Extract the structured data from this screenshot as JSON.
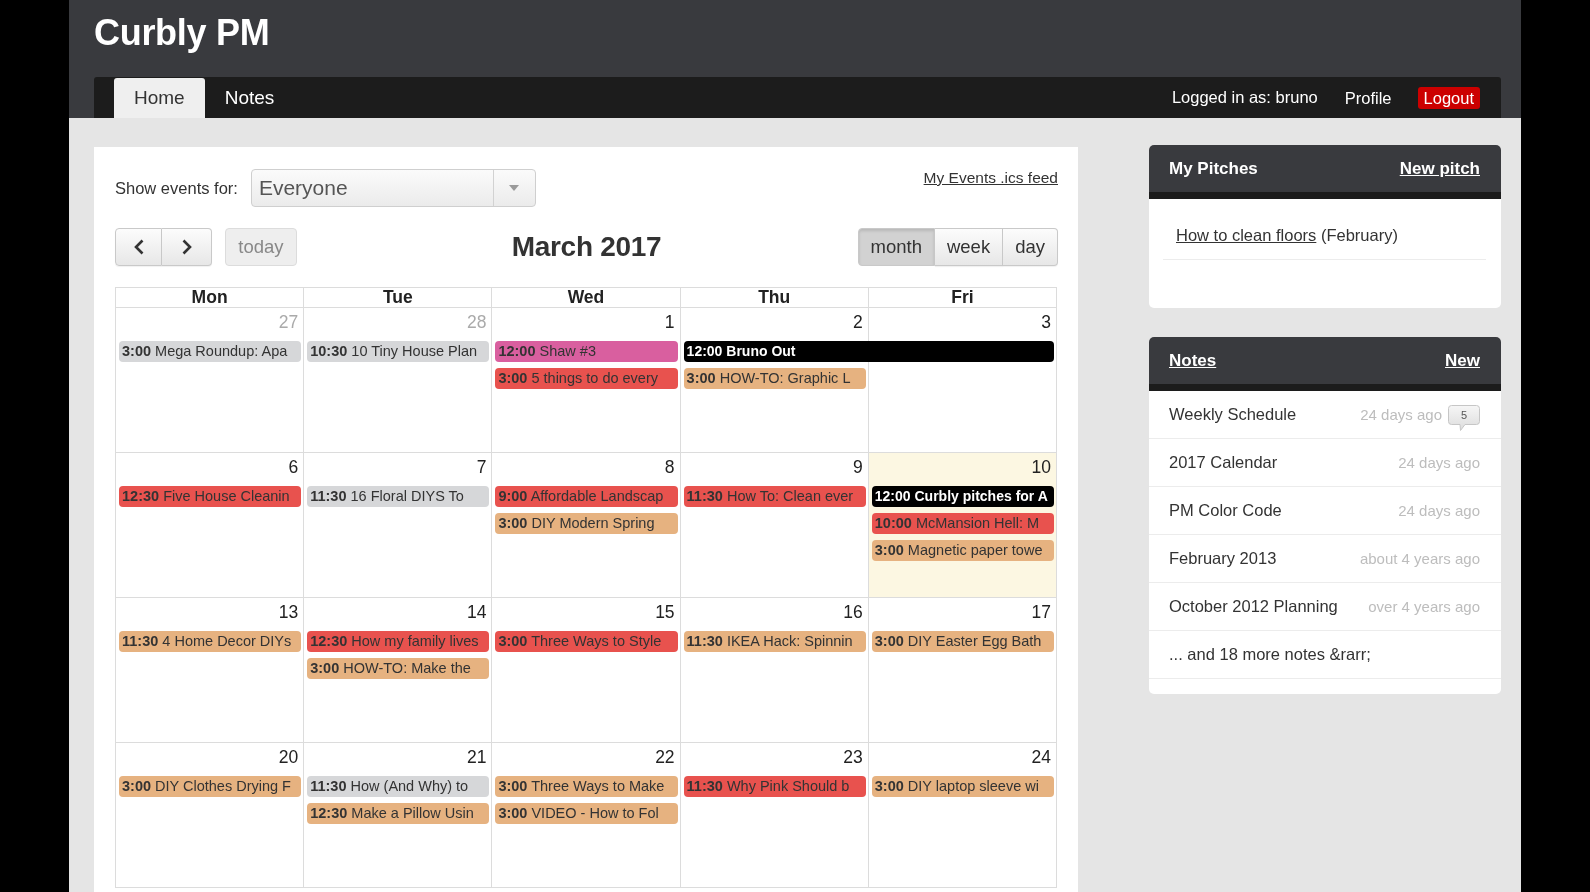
{
  "app": {
    "title": "Curbly PM"
  },
  "nav": {
    "tabs": [
      {
        "label": "Home",
        "selected": true
      },
      {
        "label": "Notes",
        "selected": false
      }
    ],
    "user": "Logged in as: bruno",
    "links": [
      {
        "label": "Profile",
        "kind": "link"
      },
      {
        "label": "Logout",
        "kind": "danger"
      }
    ]
  },
  "calendar": {
    "filter": {
      "label": "Show events for:",
      "value": "Everyone"
    },
    "feed_link": "My Events .ics feed",
    "today_button": {
      "label": "today",
      "disabled": true
    },
    "title": "March 2017",
    "views": [
      {
        "label": "month",
        "selected": true
      },
      {
        "label": "week",
        "selected": false
      },
      {
        "label": "day",
        "selected": false
      }
    ],
    "weekdays": [
      "Mon",
      "Tue",
      "Wed",
      "Thu",
      "Fri"
    ],
    "weeks": [
      {
        "days": [
          {
            "date": "27",
            "other_month": true,
            "today": false,
            "events": [
              {
                "time": "3:00",
                "title": "Mega Roundup: Apa",
                "color": "#d6d7d9",
                "spans_next_day": false
              }
            ]
          },
          {
            "date": "28",
            "other_month": true,
            "today": false,
            "events": [
              {
                "time": "10:30",
                "title": "10 Tiny House Plan",
                "color": "#d6d7d9",
                "spans_next_day": false
              }
            ]
          },
          {
            "date": "1",
            "other_month": false,
            "today": false,
            "events": [
              {
                "time": "12:00",
                "title": "Shaw #3",
                "color": "#d95f9f",
                "spans_next_day": false
              },
              {
                "time": "3:00",
                "title": "5 things to do every",
                "color": "#e8524e",
                "spans_next_day": false
              }
            ]
          },
          {
            "date": "2",
            "other_month": false,
            "today": false,
            "events": [
              {
                "time": "12:00",
                "title": "Bruno Out",
                "color": "#000000",
                "spans_next_day": true
              },
              {
                "time": "3:00",
                "title": "HOW-TO: Graphic L",
                "color": "#e6b280",
                "spans_next_day": false
              }
            ]
          },
          {
            "date": "3",
            "other_month": false,
            "today": false
          }
        ]
      },
      {
        "days": [
          {
            "date": "6",
            "other_month": false,
            "today": false,
            "events": [
              {
                "time": "12:30",
                "title": "Five House Cleanin",
                "color": "#e8524e",
                "spans_next_day": false
              }
            ]
          },
          {
            "date": "7",
            "other_month": false,
            "today": false,
            "events": [
              {
                "time": "11:30",
                "title": "16 Floral DIYS To",
                "color": "#d6d7d9",
                "spans_next_day": false
              }
            ]
          },
          {
            "date": "8",
            "other_month": false,
            "today": false,
            "events": [
              {
                "time": "9:00",
                "title": "Affordable Landscap",
                "color": "#e8524e",
                "spans_next_day": false
              },
              {
                "time": "3:00",
                "title": "DIY Modern Spring",
                "color": "#e6b280",
                "spans_next_day": false
              }
            ]
          },
          {
            "date": "9",
            "other_month": false,
            "today": false,
            "events": [
              {
                "time": "11:30",
                "title": "How To: Clean ever",
                "color": "#e8524e",
                "spans_next_day": false
              }
            ]
          },
          {
            "date": "10",
            "other_month": false,
            "today": true,
            "events": [
              {
                "time": "12:00",
                "title": "Curbly pitches for A",
                "color": "#000000",
                "spans_next_day": false
              },
              {
                "time": "10:00",
                "title": "McMansion Hell: M",
                "color": "#e8524e",
                "spans_next_day": false
              },
              {
                "time": "3:00",
                "title": "Magnetic paper towe",
                "color": "#e6b280",
                "spans_next_day": false
              }
            ]
          }
        ]
      },
      {
        "days": [
          {
            "date": "13",
            "other_month": false,
            "today": false,
            "events": [
              {
                "time": "11:30",
                "title": "4 Home Decor DIYs",
                "color": "#e6b280",
                "spans_next_day": false
              }
            ]
          },
          {
            "date": "14",
            "other_month": false,
            "today": false,
            "events": [
              {
                "time": "12:30",
                "title": "How my family lives",
                "color": "#e8524e",
                "spans_next_day": false
              },
              {
                "time": "3:00",
                "title": "HOW-TO: Make the",
                "color": "#e6b280",
                "spans_next_day": false
              }
            ]
          },
          {
            "date": "15",
            "other_month": false,
            "today": false,
            "events": [
              {
                "time": "3:00",
                "title": "Three Ways to Style",
                "color": "#e8524e",
                "spans_next_day": false
              }
            ]
          },
          {
            "date": "16",
            "other_month": false,
            "today": false,
            "events": [
              {
                "time": "11:30",
                "title": "IKEA Hack: Spinnin",
                "color": "#e6b280",
                "spans_next_day": false
              }
            ]
          },
          {
            "date": "17",
            "other_month": false,
            "today": false,
            "events": [
              {
                "time": "3:00",
                "title": "DIY Easter Egg Bath",
                "color": "#e6b280",
                "spans_next_day": false
              }
            ]
          }
        ]
      },
      {
        "days": [
          {
            "date": "20",
            "other_month": false,
            "today": false,
            "events": [
              {
                "time": "3:00",
                "title": "DIY Clothes Drying F",
                "color": "#e6b280",
                "spans_next_day": false
              }
            ]
          },
          {
            "date": "21",
            "other_month": false,
            "today": false,
            "events": [
              {
                "time": "11:30",
                "title": "How (And Why) to",
                "color": "#d6d7d9",
                "spans_next_day": false
              },
              {
                "time": "12:30",
                "title": "Make a Pillow Usin",
                "color": "#e6b280",
                "spans_next_day": false
              }
            ]
          },
          {
            "date": "22",
            "other_month": false,
            "today": false,
            "events": [
              {
                "time": "3:00",
                "title": "Three Ways to Make",
                "color": "#e6b280",
                "spans_next_day": false
              },
              {
                "time": "3:00",
                "title": "VIDEO - How to Fol",
                "color": "#e6b280",
                "spans_next_day": false
              }
            ]
          },
          {
            "date": "23",
            "other_month": false,
            "today": false,
            "events": [
              {
                "time": "11:30",
                "title": "Why Pink Should b",
                "color": "#e8524e",
                "spans_next_day": false
              }
            ]
          },
          {
            "date": "24",
            "other_month": false,
            "today": false,
            "events": [
              {
                "time": "3:00",
                "title": "DIY laptop sleeve wi",
                "color": "#e6b280",
                "spans_next_day": false
              }
            ]
          }
        ]
      }
    ]
  },
  "pitches": {
    "title": "My Pitches",
    "new_link": "New pitch",
    "items": [
      {
        "title": "How to clean floors",
        "month": "(February)"
      }
    ]
  },
  "notes": {
    "title": "Notes",
    "new_link": "New",
    "items": [
      {
        "title": "Weekly Schedule",
        "time": "24 days ago",
        "comments": "5"
      },
      {
        "title": "2017 Calendar",
        "time": "24 days ago"
      },
      {
        "title": "PM Color Code",
        "time": "24 days ago"
      },
      {
        "title": "February 2013",
        "time": "about 4 years ago"
      },
      {
        "title": "October 2012 Planning",
        "time": "over 4 years ago"
      }
    ],
    "more": "... and 18 more notes &rarr;"
  }
}
